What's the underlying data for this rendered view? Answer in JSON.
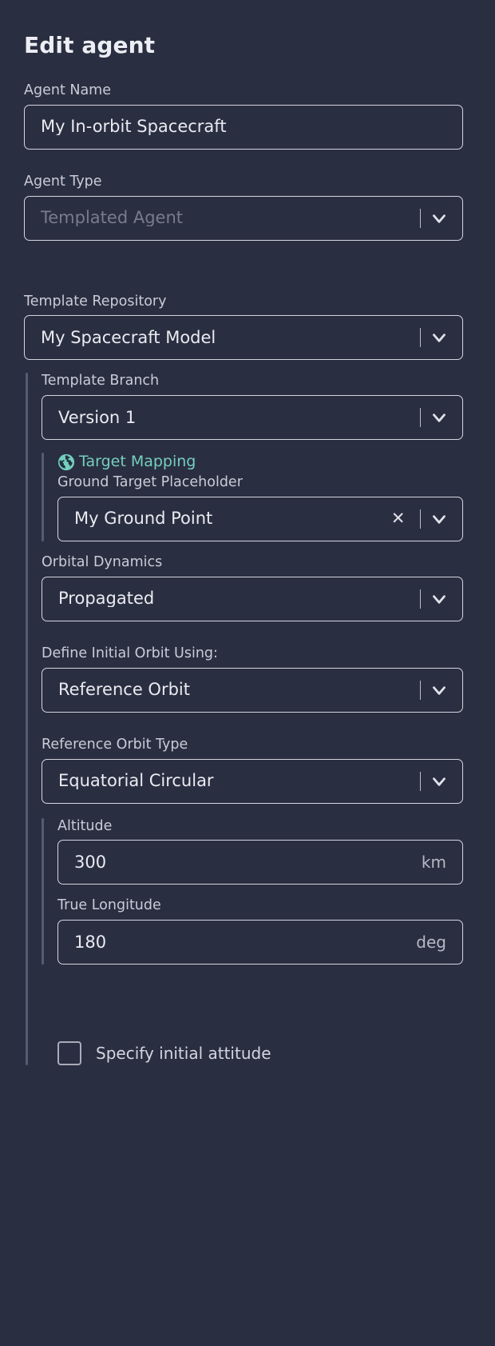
{
  "header": {
    "title": "Edit agent"
  },
  "colors": {
    "background": "#2a2e41",
    "border": "#d4d7de",
    "text": "#e9ebf0",
    "label": "#c9ccd6",
    "accent_teal": "#74cfbd",
    "rail": "#575c72",
    "placeholder": "#777b8c"
  },
  "fields": {
    "agent_name": {
      "label": "Agent Name",
      "value": "My In-orbit Spacecraft"
    },
    "agent_type": {
      "label": "Agent Type",
      "value": "Templated Agent",
      "is_placeholder": true
    },
    "template_repository": {
      "label": "Template Repository",
      "value": "My Spacecraft Model"
    },
    "template_branch": {
      "label": "Template Branch",
      "value": "Version 1"
    },
    "target_mapping": {
      "heading": "Target Mapping",
      "icon": "globe-icon"
    },
    "ground_target_placeholder": {
      "label": "Ground Target Placeholder",
      "value": "My Ground Point",
      "clear_label": "✕"
    },
    "orbital_dynamics": {
      "label": "Orbital Dynamics",
      "value": "Propagated"
    },
    "define_initial_orbit_using": {
      "label": "Define Initial Orbit Using:",
      "value": "Reference Orbit"
    },
    "reference_orbit_type": {
      "label": "Reference Orbit Type",
      "value": "Equatorial Circular"
    },
    "altitude": {
      "label": "Altitude",
      "value": "300",
      "unit": "km"
    },
    "true_longitude": {
      "label": "True Longitude",
      "value": "180",
      "unit": "deg"
    },
    "specify_initial_attitude": {
      "label": "Specify initial attitude",
      "checked": false
    }
  }
}
